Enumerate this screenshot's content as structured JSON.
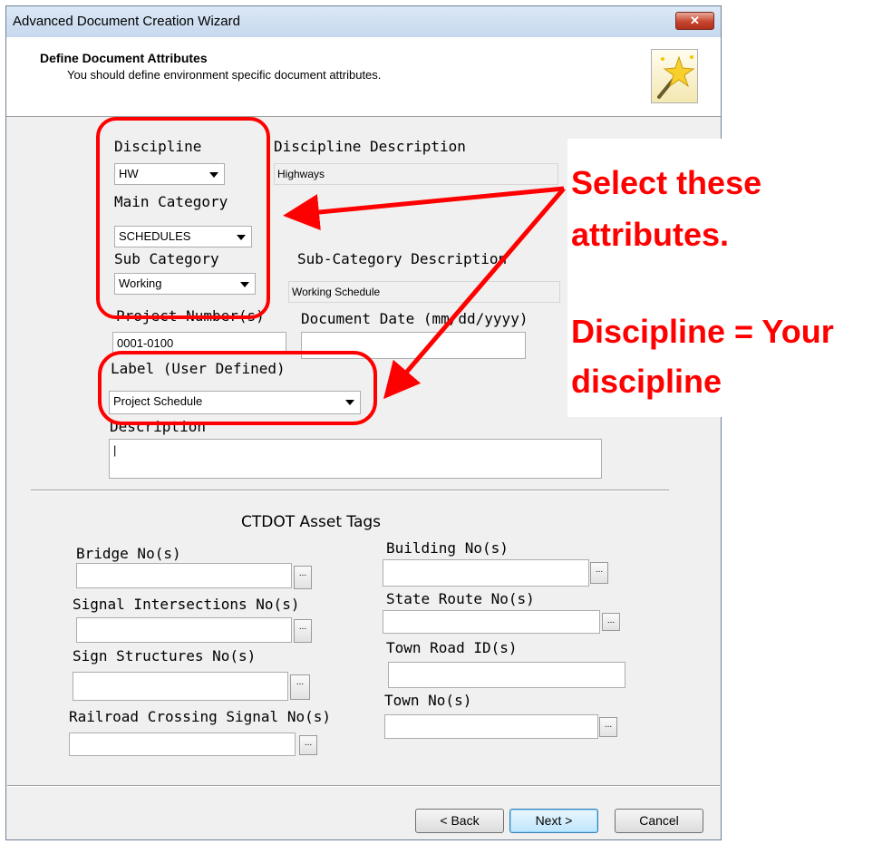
{
  "window": {
    "title": "Advanced Document Creation Wizard",
    "close_glyph": "✕"
  },
  "header": {
    "title": "Define Document Attributes",
    "subtitle": "You should define environment specific document attributes.",
    "icon": "wizard-wand-icon"
  },
  "fields": {
    "discipline": {
      "label": "Discipline",
      "value": "HW"
    },
    "discipline_description": {
      "label": "Discipline Description",
      "value": "Highways"
    },
    "main_category": {
      "label": "Main Category",
      "value": "SCHEDULES"
    },
    "sub_category": {
      "label": "Sub Category",
      "value": "Working"
    },
    "sub_category_description": {
      "label": "Sub-Category Description",
      "value": "Working Schedule"
    },
    "project_numbers": {
      "label": "Project Number(s)",
      "value": "0001-0100"
    },
    "document_date": {
      "label": "Document Date (mm/dd/yyyy)",
      "value": ""
    },
    "label": {
      "label": "Label (User Defined)",
      "value": "Project Schedule"
    },
    "description": {
      "label": "Description",
      "value": "|"
    }
  },
  "asset_tags": {
    "heading": "CTDOT Asset Tags",
    "bridge": {
      "label": "Bridge No(s)"
    },
    "signal_intersections": {
      "label": "Signal Intersections No(s)"
    },
    "sign_structures": {
      "label": "Sign Structures No(s)"
    },
    "railroad_crossing": {
      "label": "Railroad Crossing Signal No(s)"
    },
    "building": {
      "label": "Building No(s)"
    },
    "state_route": {
      "label": "State Route No(s)"
    },
    "town_road": {
      "label": "Town Road ID(s)"
    },
    "town": {
      "label": "Town No(s)"
    },
    "ellipsis": "..."
  },
  "buttons": {
    "back": "< Back",
    "next": "Next >",
    "cancel": "Cancel"
  },
  "annotation": {
    "line1": "Select these",
    "line2": "attributes.",
    "line3": "Discipline = Your",
    "line4": "discipline",
    "color": "#ff0000"
  }
}
